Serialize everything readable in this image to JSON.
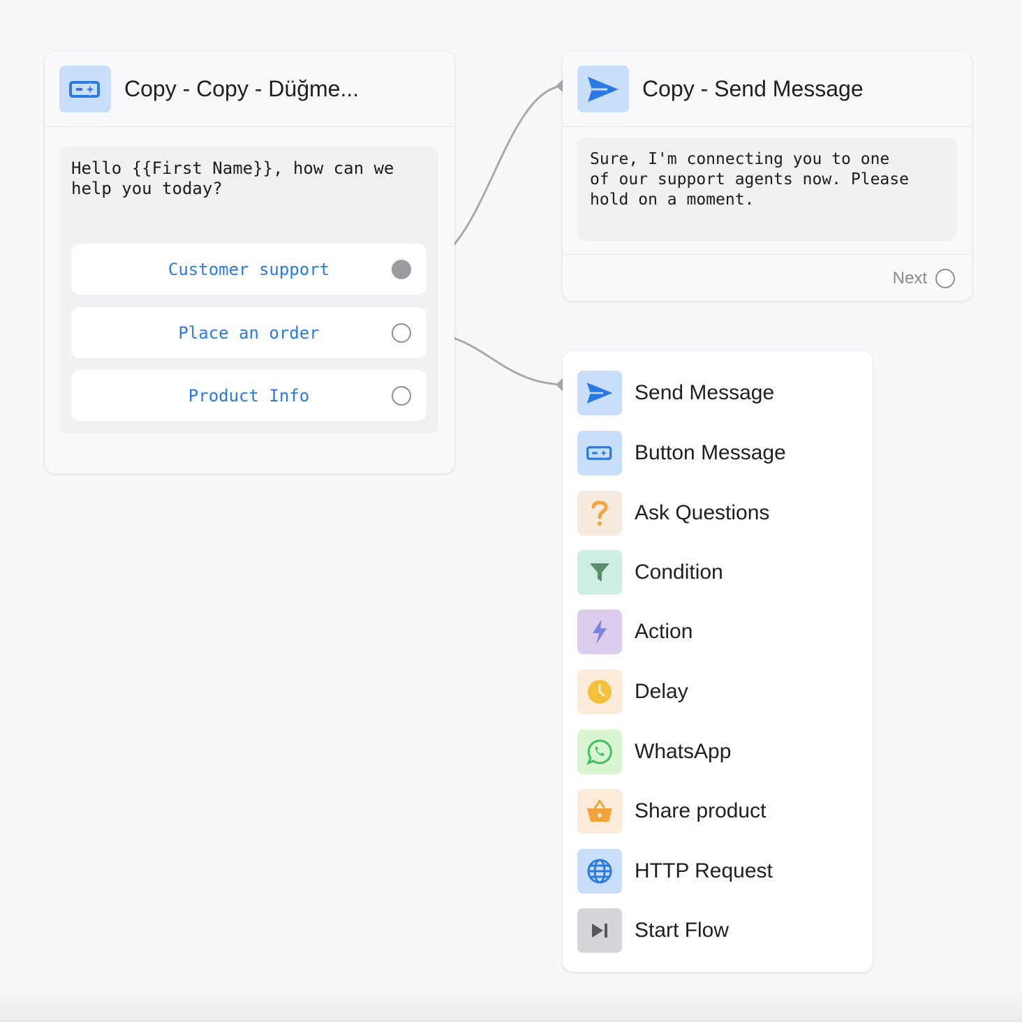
{
  "button_node": {
    "title": "Copy - Copy - Düğme...",
    "icon": "button-message-icon",
    "message": "Hello {{First Name}}, how can we\nhelp you today?",
    "options": [
      {
        "label": "Customer support",
        "connected": true
      },
      {
        "label": "Place an order",
        "connected": true
      },
      {
        "label": "Product Info",
        "connected": false
      }
    ]
  },
  "send_node": {
    "title": "Copy - Send Message",
    "icon": "send-icon",
    "message": "Sure, I'm connecting you to one\nof our support agents now. Please\nhold on a moment.",
    "next_label": "Next"
  },
  "node_menu": {
    "items": [
      {
        "label": "Send Message",
        "icon": "send-icon",
        "bg": "#c8def9"
      },
      {
        "label": "Button Message",
        "icon": "button-message-icon",
        "bg": "#c8def9"
      },
      {
        "label": "Ask Questions",
        "icon": "question-icon",
        "bg": "#f7ebe0"
      },
      {
        "label": "Condition",
        "icon": "filter-icon",
        "bg": "#cdeee0"
      },
      {
        "label": "Action",
        "icon": "lightning-icon",
        "bg": "#dccdee"
      },
      {
        "label": "Delay",
        "icon": "clock-icon",
        "bg": "#fcebd8"
      },
      {
        "label": "WhatsApp",
        "icon": "whatsapp-icon",
        "bg": "#daf5d2"
      },
      {
        "label": "Share product",
        "icon": "basket-icon",
        "bg": "#fcebd8"
      },
      {
        "label": "HTTP Request",
        "icon": "globe-icon",
        "bg": "#c8def9"
      },
      {
        "label": "Start Flow",
        "icon": "skip-icon",
        "bg": "#d6d6da"
      }
    ]
  },
  "colors": {
    "accent_blue": "#2b7ae4",
    "connector_gray": "#a8a8ad"
  }
}
